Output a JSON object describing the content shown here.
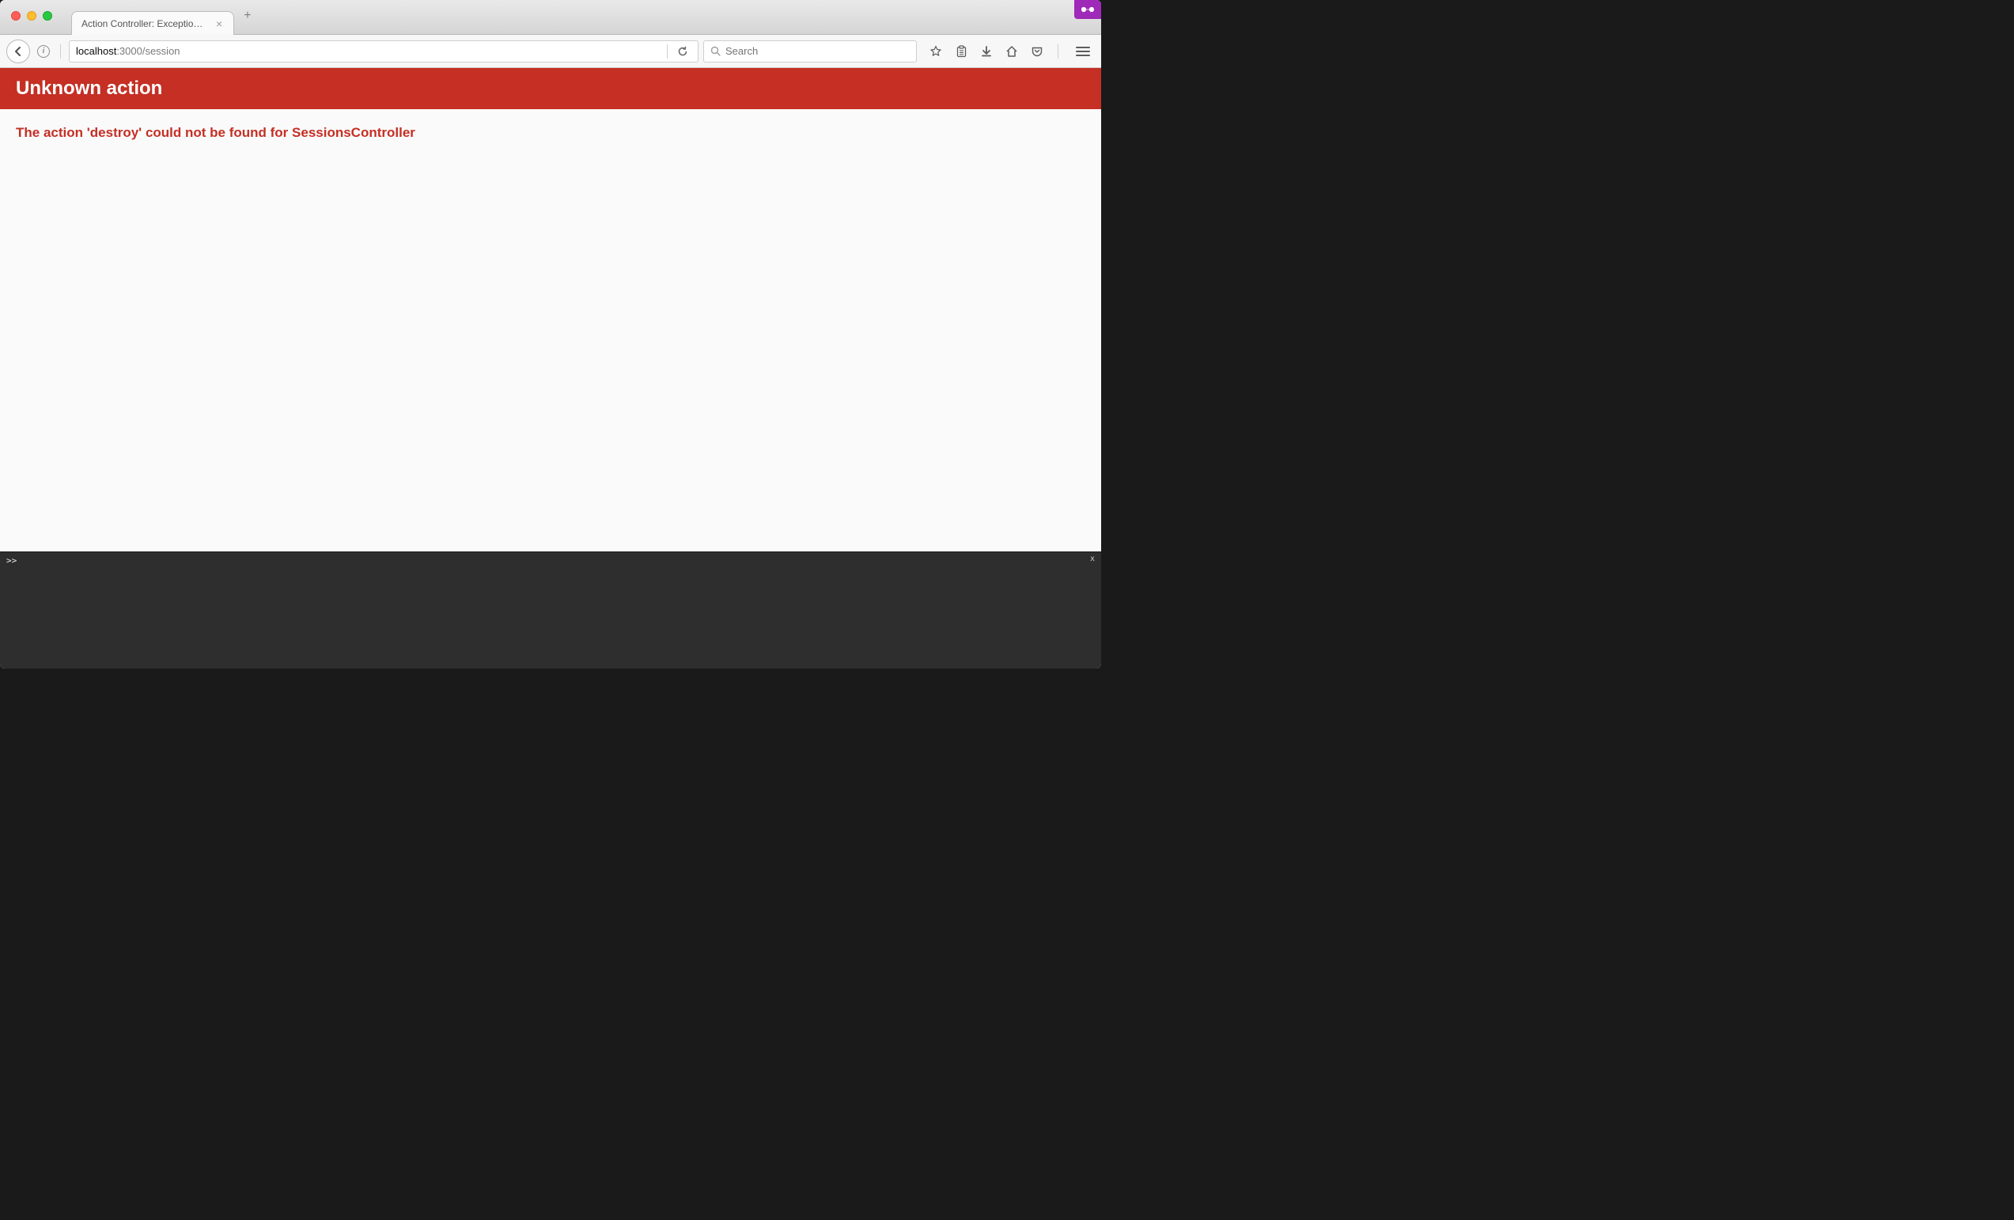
{
  "tabbar": {
    "tab_title": "Action Controller: Exception ca...",
    "tab_close": "×",
    "newtab": "+"
  },
  "navbar": {
    "info_glyph": "i",
    "address_host": "localhost",
    "address_path": ":3000/session",
    "search_placeholder": "Search"
  },
  "page": {
    "error_title": "Unknown action",
    "error_message": "The action 'destroy' could not be found for SessionsController"
  },
  "console": {
    "prompt": ">>",
    "close": "x"
  },
  "colors": {
    "error_red": "#c52f24",
    "ext_purple": "#9f29b8"
  }
}
